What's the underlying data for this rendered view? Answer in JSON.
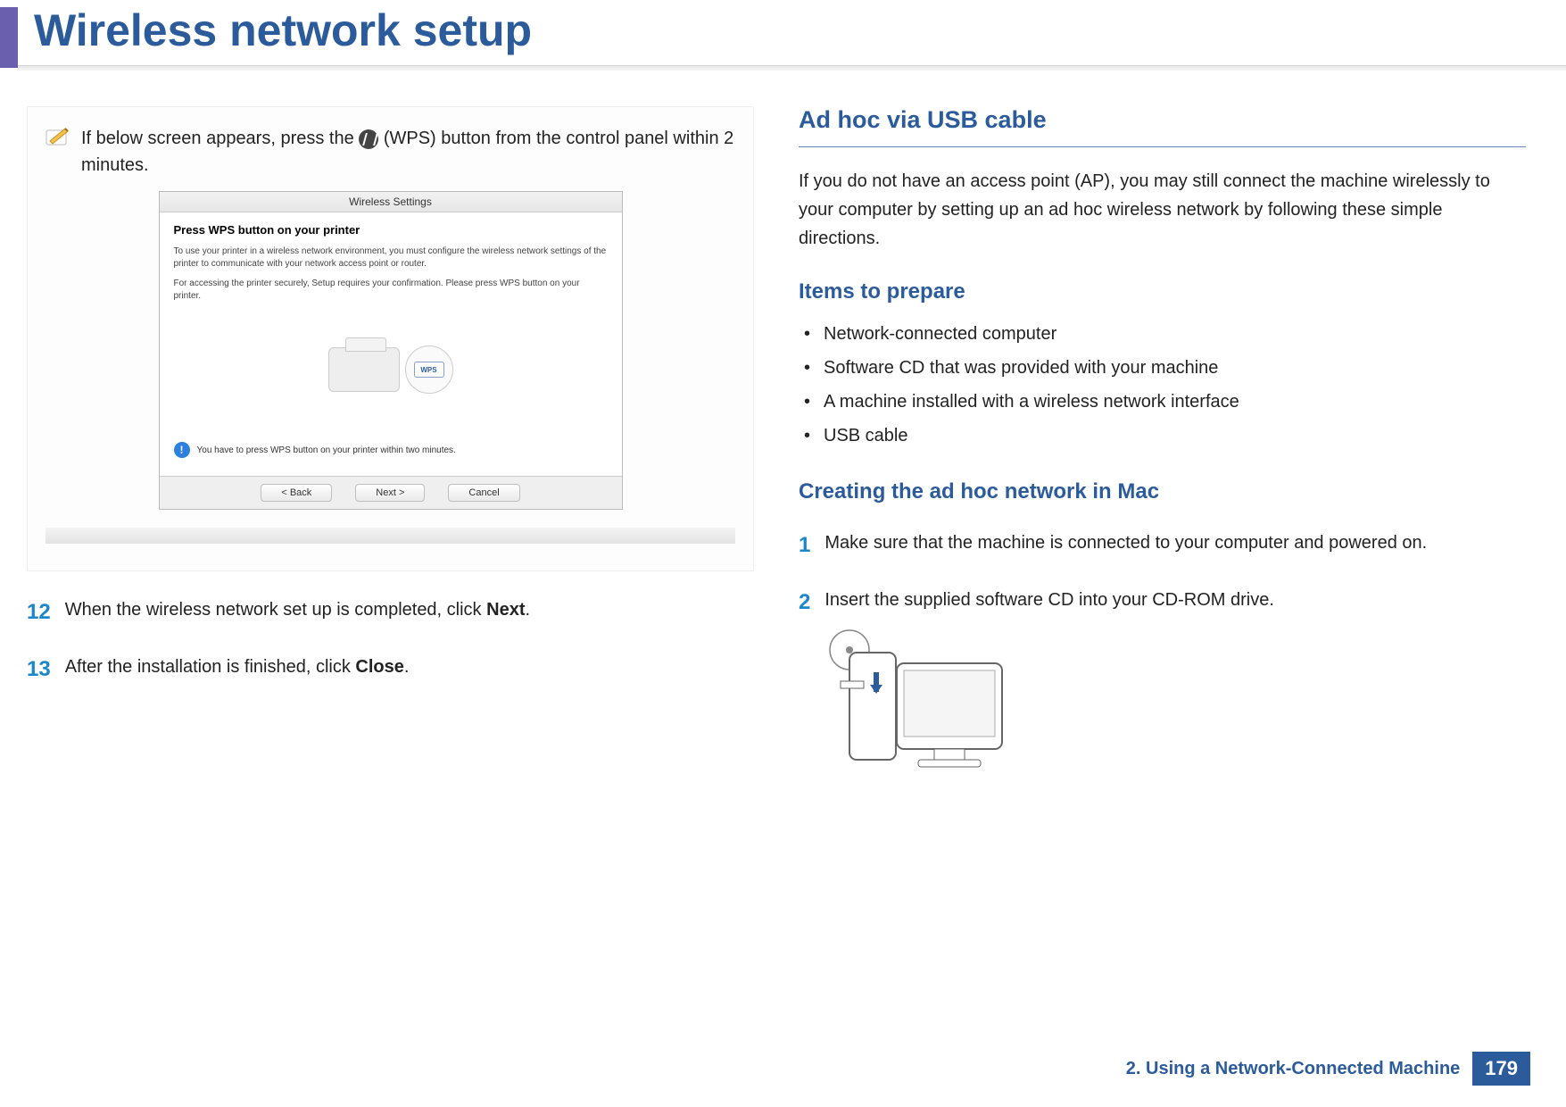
{
  "header": {
    "title": "Wireless network setup"
  },
  "left": {
    "note": {
      "text_before": "If below screen appears, press the ",
      "text_after": " (WPS) button from the control panel within 2 minutes."
    },
    "dialog": {
      "title": "Wireless Settings",
      "heading": "Press WPS button on your printer",
      "para1": "To use your printer in a wireless network environment, you must configure the wireless network settings of the printer to communicate with your network access point or router.",
      "para2": "For accessing the printer securely, Setup requires your confirmation. Please press WPS button on your printer.",
      "wps_label": "WPS",
      "alert": "You have to press WPS button on your printer within two minutes.",
      "buttons": {
        "back": "< Back",
        "next": "Next >",
        "cancel": "Cancel"
      }
    },
    "steps": {
      "s12_num": "12",
      "s12_a": "When the wireless network set up is completed, click ",
      "s12_b": "Next",
      "s12_c": ".",
      "s13_num": "13",
      "s13_a": "After the installation is finished, click ",
      "s13_b": "Close",
      "s13_c": "."
    }
  },
  "right": {
    "h2": "Ad hoc via USB cable",
    "intro": "If you do not have an access point (AP), you may still connect the machine wirelessly to your computer by setting up an ad hoc wireless network by following these simple directions.",
    "items_heading": "Items to prepare",
    "items": [
      "Network-connected computer",
      "Software CD that was provided with your machine",
      "A machine installed with a wireless network interface",
      "USB cable"
    ],
    "h3": "Creating the ad hoc network in Mac",
    "steps": {
      "s1_num": "1",
      "s1": "Make sure that the machine is connected to your computer and powered on.",
      "s2_num": "2",
      "s2": "Insert the supplied software CD into your CD-ROM drive."
    }
  },
  "footer": {
    "chapter": "2.  Using a Network-Connected Machine",
    "page": "179"
  }
}
